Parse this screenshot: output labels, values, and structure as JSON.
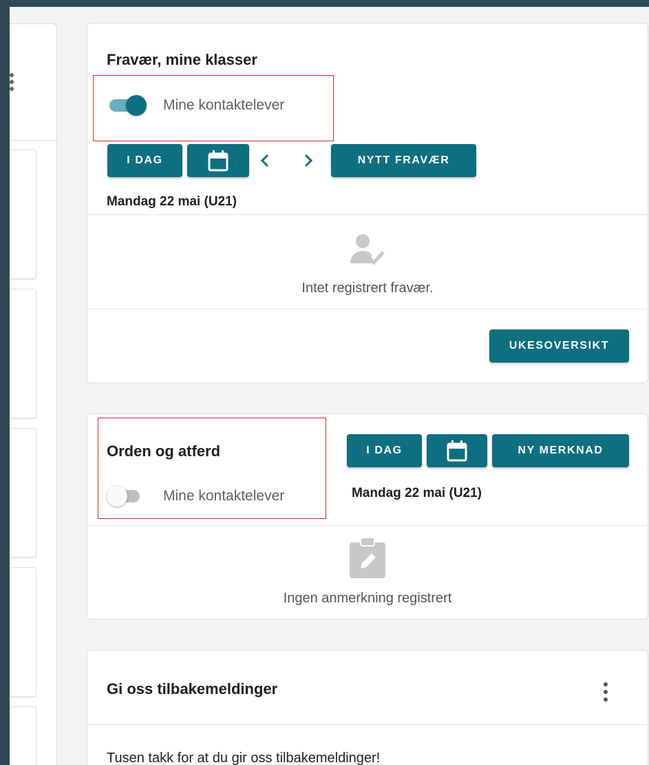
{
  "colors": {
    "primary": "#0e6f80",
    "toggle_on_track": "#6aaebb",
    "toggle_on_knob": "#0e6f80",
    "toggle_off_track": "#bdbdbd",
    "toggle_off_knob": "#fafafa",
    "highlight": "#e0262b",
    "frame_background": "#2f4a55"
  },
  "left_panel": {
    "menu_icon": "vertical-dots-icon"
  },
  "absence_card": {
    "title": "Fravær, mine klasser",
    "toggle": {
      "label": "Mine kontaktelever",
      "on": true
    },
    "today_label": "I DAG",
    "calendar_icon": "calendar-icon",
    "prev_icon": "chevron-left-icon",
    "next_icon": "chevron-right-icon",
    "new_absence_label": "NYTT FRAVÆR",
    "date": "Mandag 22 mai (U21)",
    "empty_icon": "person-check-icon",
    "empty_text": "Intet registrert fravær.",
    "week_overview_label": "UKESOVERSIKT"
  },
  "conduct_card": {
    "title": "Orden og atferd",
    "toggle": {
      "label": "Mine kontaktelever",
      "on": false
    },
    "today_label": "I DAG",
    "calendar_icon": "calendar-icon",
    "new_remark_label": "NY MERKNAD",
    "date": "Mandag 22 mai (U21)",
    "empty_icon": "clipboard-edit-icon",
    "empty_text": "Ingen anmerkning registrert"
  },
  "feedback_card": {
    "title": "Gi oss tilbakemeldinger",
    "menu_icon": "vertical-dots-icon",
    "body_text": "Tusen takk for at du gir oss tilbakemeldinger!"
  }
}
